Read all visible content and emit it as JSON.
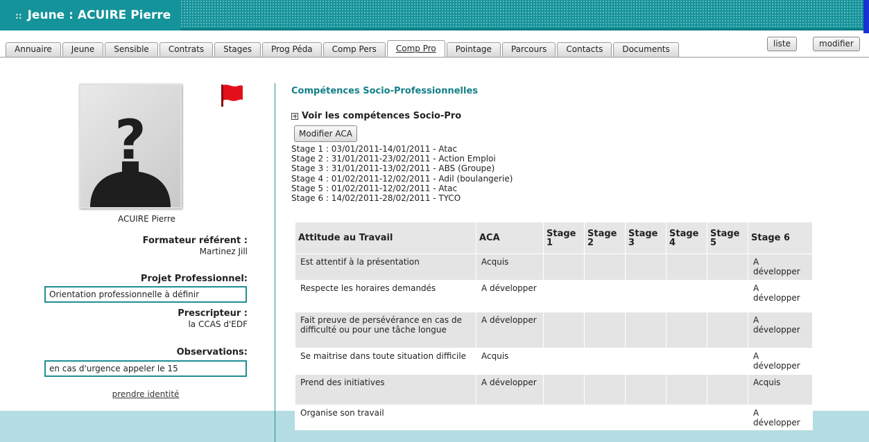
{
  "header": {
    "prefix": "::",
    "title": "Jeune : ACUIRE Pierre"
  },
  "tabs": [
    {
      "label": "Annuaire",
      "active": false
    },
    {
      "label": "Jeune",
      "active": false
    },
    {
      "label": "Sensible",
      "active": false
    },
    {
      "label": "Contrats",
      "active": false
    },
    {
      "label": "Stages",
      "active": false
    },
    {
      "label": "Prog Péda",
      "active": false
    },
    {
      "label": "Comp Pers",
      "active": false
    },
    {
      "label": "Comp Pro",
      "active": true
    },
    {
      "label": "Pointage",
      "active": false
    },
    {
      "label": "Parcours",
      "active": false
    },
    {
      "label": "Contacts",
      "active": false
    },
    {
      "label": "Documents",
      "active": false
    }
  ],
  "actions": {
    "liste": "liste",
    "modifier": "modifier"
  },
  "profile": {
    "name": "ACUIRE Pierre",
    "formateur_label": "Formateur référent :",
    "formateur_value": "Martinez Jill",
    "projet_label": "Projet Professionnel:",
    "projet_value": "Orientation professionnelle à définir",
    "prescripteur_label": "Prescripteur :",
    "prescripteur_value": "la CCAS d'EDF",
    "observations_label": "Observations:",
    "observations_value": "en cas d'urgence appeler le 15",
    "identity_link": "prendre identité",
    "flag_color": "#e3101b"
  },
  "competences": {
    "title": "Compétences Socio-Professionnelles",
    "toggle_label": "Voir les compétences Socio-Pro",
    "modify_button": "Modifier ACA",
    "stages": [
      "Stage 1 : 03/01/2011-14/01/2011 - Atac",
      "Stage 2 : 31/01/2011-23/02/2011 - Action Emploi",
      "Stage 3 : 31/01/2011-13/02/2011 - ABS (Groupe)",
      "Stage 4 : 01/02/2011-12/02/2011 - Adil (boulangerie)",
      "Stage 5 : 01/02/2011-12/02/2011 - Atac",
      "Stage 6 : 14/02/2011-28/02/2011 - TYCO"
    ],
    "table": {
      "headers": [
        "Attitude au Travail",
        "ACA",
        "Stage 1",
        "Stage 2",
        "Stage 3",
        "Stage 4",
        "Stage 5",
        "Stage 6"
      ],
      "rows": [
        [
          "Est attentif à la présentation",
          "Acquis",
          "",
          "",
          "",
          "",
          "",
          "A développer"
        ],
        [
          "Respecte les horaires demandés",
          "A développer",
          "",
          "",
          "",
          "",
          "",
          "A développer"
        ],
        [
          "Fait preuve de persévérance en cas de difficulté ou pour une tâche longue",
          "A développer",
          "",
          "",
          "",
          "",
          "",
          "A développer"
        ],
        [
          "Se maitrise dans toute situation difficile",
          "Acquis",
          "",
          "",
          "",
          "",
          "",
          "A développer"
        ],
        [
          "Prend des initiatives",
          "A développer",
          "",
          "",
          "",
          "",
          "",
          "Acquis"
        ],
        [
          "Organise son travail",
          "",
          "",
          "",
          "",
          "",
          "",
          "A développer"
        ]
      ]
    }
  }
}
